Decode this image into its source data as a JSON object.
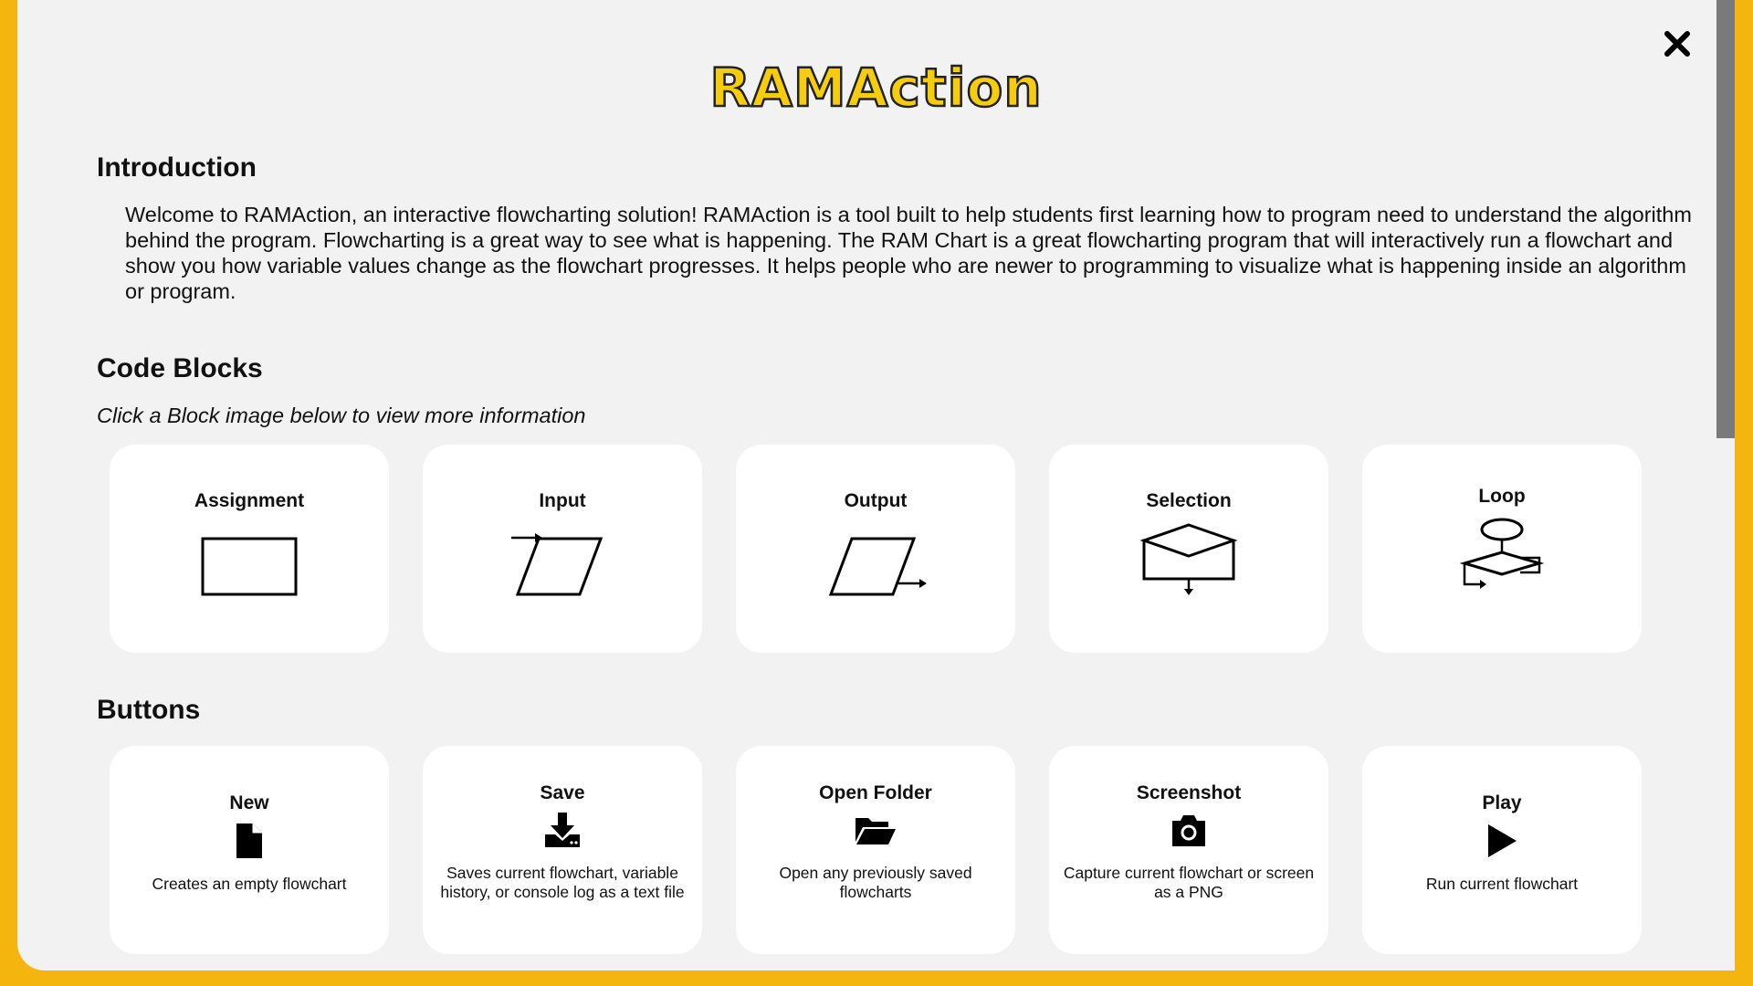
{
  "app": {
    "title": "RAMAction"
  },
  "intro": {
    "heading": "Introduction",
    "text": "Welcome to RAMAction, an interactive flowcharting solution! RAMAction is a tool built to help students first learning how to program need to understand the algorithm behind the program. Flowcharting is a great way to see what is happening. The RAM Chart is a great flowcharting program that will interactively run a flowchart and show you how variable values change as the flowchart progresses. It helps people who are newer to programming to visualize what is happening inside an algorithm or program."
  },
  "code_blocks": {
    "heading": "Code Blocks",
    "hint": "Click a Block image below to view more information",
    "items": [
      {
        "label": "Assignment",
        "icon": "assignment-block-icon"
      },
      {
        "label": "Input",
        "icon": "input-block-icon"
      },
      {
        "label": "Output",
        "icon": "output-block-icon"
      },
      {
        "label": "Selection",
        "icon": "selection-block-icon"
      },
      {
        "label": "Loop",
        "icon": "loop-block-icon"
      }
    ]
  },
  "buttons": {
    "heading": "Buttons",
    "items": [
      {
        "label": "New",
        "icon": "file-icon",
        "desc": "Creates an empty flowchart"
      },
      {
        "label": "Save",
        "icon": "download-icon",
        "desc": "Saves current flowchart, variable history, or console log as a text file"
      },
      {
        "label": "Open Folder",
        "icon": "folder-open-icon",
        "desc": "Open any previously saved flowcharts"
      },
      {
        "label": "Screenshot",
        "icon": "camera-icon",
        "desc": "Capture current flowchart or screen as a PNG"
      },
      {
        "label": "Play",
        "icon": "play-icon",
        "desc": "Run current flowchart"
      }
    ]
  },
  "colors": {
    "page_background": "#f5b50f",
    "modal_background": "#f2f2f2",
    "title_fill": "#f6cd0e",
    "card_background": "#ffffff"
  }
}
